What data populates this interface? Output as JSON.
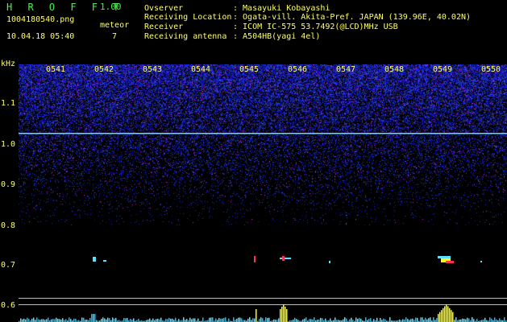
{
  "header": {
    "app_name": "H R O F F T",
    "version": "1.00",
    "filename": "1004180540.png",
    "meteor_label": "meteor",
    "datetime": "10.04.18 05:40",
    "meteor_count": "7"
  },
  "meta": [
    {
      "key": "Ovserver",
      "value": ": Masayuki Kobayashi"
    },
    {
      "key": "Receiving Location",
      "value": ": Ogata-vill. Akita-Pref. JAPAN (139.96E, 40.02N)"
    },
    {
      "key": "Receiver",
      "value": ": ICOM IC-575 53.7492(@LCD)MHz USB"
    },
    {
      "key": "Receiving antenna",
      "value": ": A504HB(yagi 4el)"
    }
  ],
  "axis": {
    "y_unit": "kHz",
    "y_ticks": [
      "1.1",
      "1.0",
      "0.9",
      "0.8",
      "0.7",
      "0.6"
    ],
    "x_ticks": [
      "0541",
      "0542",
      "0543",
      "0544",
      "0545",
      "0546",
      "0547",
      "0548",
      "0549",
      "0550"
    ]
  },
  "colors": {
    "label": "#ffff66",
    "title": "#4ef04e",
    "noise": "#2a2ad8",
    "carrier": "#58e0ff",
    "echo": "#ff3050",
    "bars": "#ffff00"
  }
}
